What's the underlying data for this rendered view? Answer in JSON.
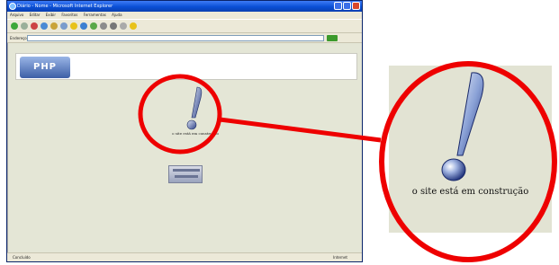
{
  "browser": {
    "title": "Diário - Nome - Microsoft Internet Explorer",
    "menu": [
      "Arquivo",
      "Editar",
      "Exibir",
      "Favoritos",
      "Ferramentas",
      "Ajuda"
    ],
    "address_label": "Endereço",
    "status_left": "Concluído",
    "status_right": "Internet"
  },
  "page": {
    "logo_text": "PHP",
    "caption": "o site está em construção"
  },
  "zoom": {
    "caption": "o site está em construção"
  },
  "colors": {
    "highlight": "#ee0000",
    "titlebar": "#0a4fd6",
    "page_bg": "#e4e6d6"
  }
}
